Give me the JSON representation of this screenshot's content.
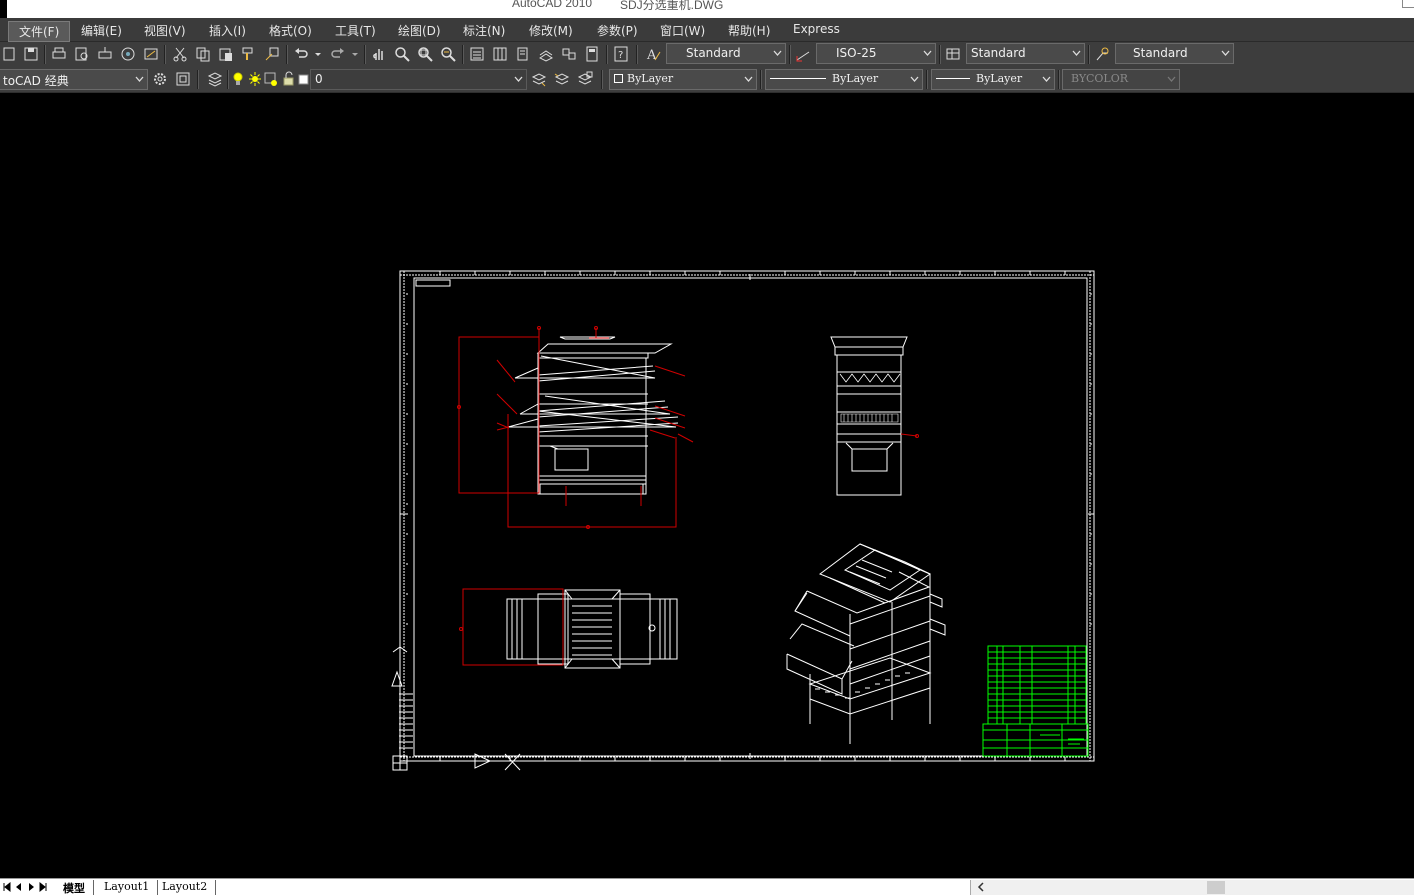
{
  "window": {
    "app_name": "AutoCAD 2010",
    "file_name": "SDJ分选重机.DWG"
  },
  "menu": [
    {
      "id": "file",
      "label": "文件(F)",
      "active": true
    },
    {
      "id": "edit",
      "label": "编辑(E)"
    },
    {
      "id": "view",
      "label": "视图(V)"
    },
    {
      "id": "insert",
      "label": "插入(I)"
    },
    {
      "id": "format",
      "label": "格式(O)"
    },
    {
      "id": "tools",
      "label": "工具(T)"
    },
    {
      "id": "draw",
      "label": "绘图(D)"
    },
    {
      "id": "dimension",
      "label": "标注(N)"
    },
    {
      "id": "modify",
      "label": "修改(M)"
    },
    {
      "id": "parameters",
      "label": "参数(P)"
    },
    {
      "id": "window",
      "label": "窗口(W)"
    },
    {
      "id": "help",
      "label": "帮助(H)"
    },
    {
      "id": "express",
      "label": "Express"
    }
  ],
  "styles_toolbar": {
    "text_style": "Standard",
    "dim_style": "ISO-25",
    "table_style": "Standard",
    "multileader_style": "Standard"
  },
  "layers_toolbar": {
    "workspace": "toCAD 经典",
    "current_layer": "0",
    "color": "ByLayer",
    "linetype": "ByLayer",
    "lineweight": "ByLayer",
    "plot_style": "BYCOLOR"
  },
  "layout_tabs": {
    "model": "模型",
    "layout1": "Layout1",
    "layout2": "Layout2"
  },
  "colors": {
    "background": "#000000",
    "drawing_lines": "#ffffff",
    "dimension_lines": "#cc0000",
    "title_block": "#00ff00",
    "toolbar_bg": "#3d3d3d"
  },
  "icons": {
    "toolbar_standard": [
      "new-icon",
      "save-icon",
      "plot-icon",
      "plot-preview-icon",
      "publish-icon",
      "3d-dwf-icon",
      "etransmit-icon",
      "cut-icon",
      "copy-icon",
      "paste-icon",
      "match-properties-icon",
      "block-editor-icon",
      "undo-icon",
      "redo-icon",
      "pan-icon",
      "zoom-realtime-icon",
      "zoom-window-icon",
      "zoom-previous-icon",
      "properties-icon",
      "design-center-icon",
      "tool-palettes-icon",
      "sheet-set-icon",
      "markup-icon",
      "calculator-icon",
      "help-icon"
    ]
  }
}
